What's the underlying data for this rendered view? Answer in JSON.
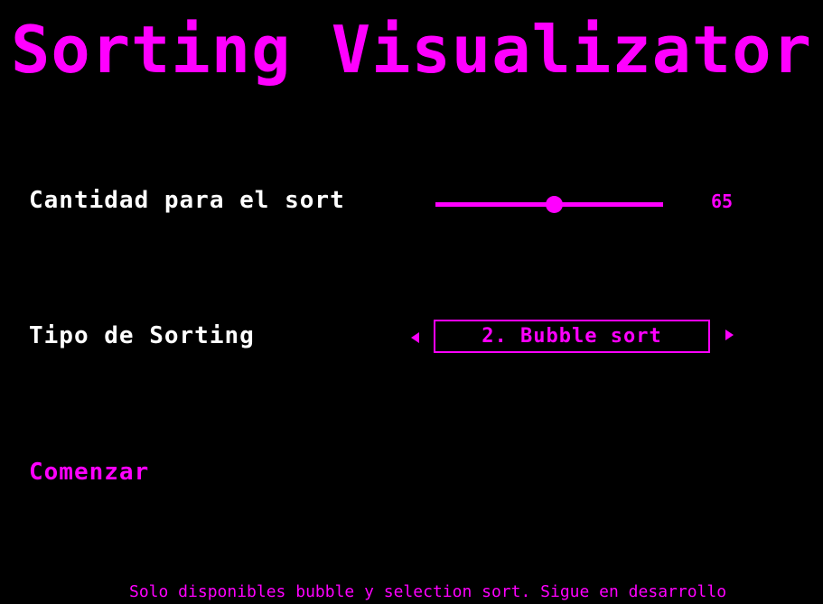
{
  "title": "Sorting Visualizator",
  "amount": {
    "label": "Cantidad para el sort",
    "value": "65",
    "slider_fraction": 0.52
  },
  "sort_type": {
    "label": "Tipo de Sorting",
    "selected": "2. Bubble sort"
  },
  "start_label": "Comenzar",
  "footer": "Solo disponibles bubble y selection sort. Sigue en desarrollo",
  "colors": {
    "accent": "#ff00ff",
    "background": "#000000",
    "text": "#ffffff"
  },
  "icons": {
    "prev": "triangle-left-icon",
    "next": "triangle-right-icon"
  }
}
